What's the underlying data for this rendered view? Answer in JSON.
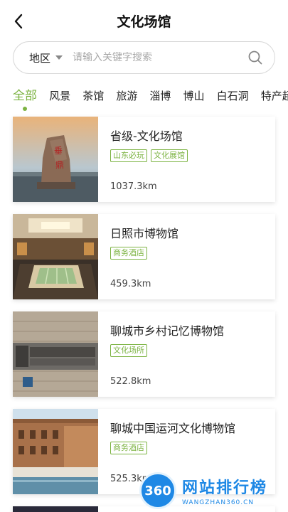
{
  "header": {
    "title": "文化场馆"
  },
  "search": {
    "region_label": "地区",
    "placeholder": "请输入关键字搜索"
  },
  "tabs": [
    {
      "label": "全部",
      "active": true
    },
    {
      "label": "风景"
    },
    {
      "label": "茶馆"
    },
    {
      "label": "旅游"
    },
    {
      "label": "淄博"
    },
    {
      "label": "博山"
    },
    {
      "label": "白石洞"
    },
    {
      "label": "特产超"
    }
  ],
  "items": [
    {
      "title": "省级-文化场馆",
      "tags": [
        "山东必玩",
        "文化展馆"
      ],
      "distance": "1037.3km",
      "image": "carved-stone-monument"
    },
    {
      "title": "日照市博物馆",
      "tags": [
        "商务酒店"
      ],
      "distance": "459.3km",
      "image": "museum-hall-interior"
    },
    {
      "title": "聊城市乡村记忆博物馆",
      "tags": [
        "文化场所"
      ],
      "distance": "522.8km",
      "image": "brick-wall-sign"
    },
    {
      "title": "聊城中国运河文化博物馆",
      "tags": [
        "商务酒店"
      ],
      "distance": "525.3km",
      "image": "museum-building-exterior"
    }
  ],
  "watermark": {
    "badge": "360",
    "cn": "网站排行榜",
    "en": "WANGZHAN360.CN"
  },
  "colors": {
    "accent": "#7cb342",
    "watermark": "#1e88e5"
  }
}
